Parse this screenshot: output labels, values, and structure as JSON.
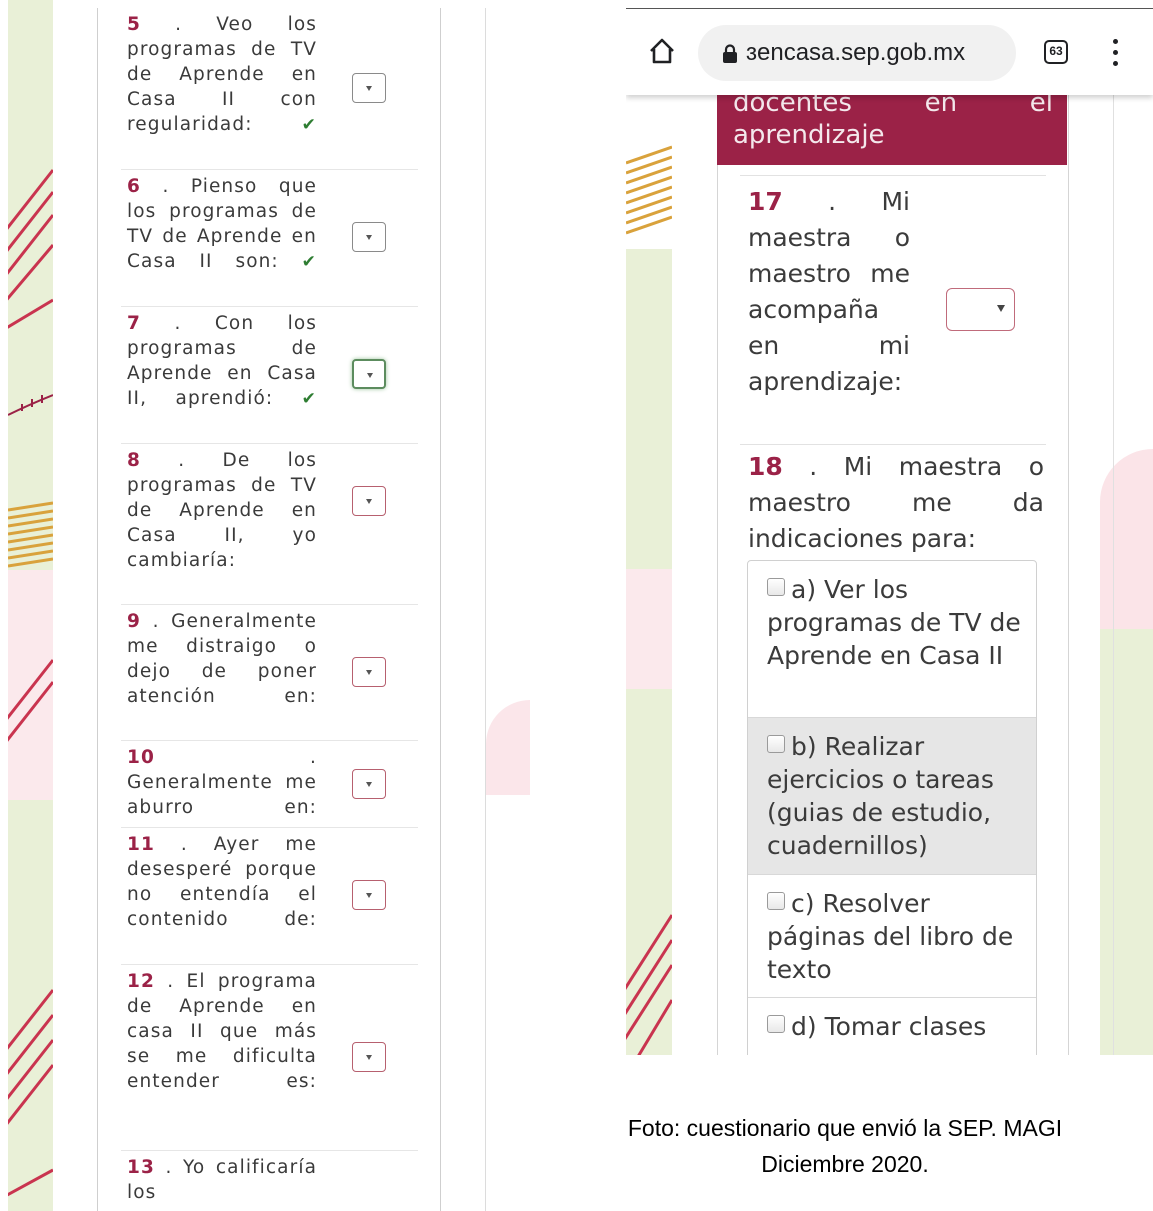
{
  "left_screen": {
    "questions": [
      {
        "number": "5",
        "text": ". Veo los programas de TV de Aprende en Casa II con regularidad:",
        "answered": true
      },
      {
        "number": "6",
        "text": ". Pienso que los programas de TV de Aprende en Casa II son:",
        "answered": true
      },
      {
        "number": "7",
        "text": ". Con los programas de Aprende en Casa II, aprendió:",
        "answered": true
      },
      {
        "number": "8",
        "text": ". De los programas de TV de Aprende en Casa II, yo cambiaría:",
        "answered": false
      },
      {
        "number": "9",
        "text": ". Generalmente me distraigo o dejo de poner atención en:",
        "answered": false
      },
      {
        "number": "10",
        "text": ". Generalmente me aburro en:",
        "answered": false
      },
      {
        "number": "11",
        "text": ". Ayer me desesperé porque no entendía el contenido de:",
        "answered": false
      },
      {
        "number": "12",
        "text": ". El programa de Aprende en casa II que más se me dificulta entender es:",
        "answered": false
      },
      {
        "number": "13",
        "text": ". Yo calificaría los",
        "answered": false
      }
    ],
    "check_glyph": "✔"
  },
  "right_screen": {
    "browser": {
      "url": "ɜencasa.sep.gob.mx",
      "tab_count": "63"
    },
    "section_header": {
      "line1_words": [
        "docentes",
        "en",
        "el"
      ],
      "line2": "aprendizaje"
    },
    "q17": {
      "number": "17",
      "text": ". Mi maestra o maestro me acompaña en mi aprendizaje:"
    },
    "q18": {
      "number": "18",
      "text": ". Mi maestra o maestro me da indicaciones para:",
      "options": [
        {
          "label": "a) Ver los programas de TV de Aprende en Casa II",
          "shaded": false
        },
        {
          "label": "b) Realizar ejercicios o tareas (guias de estudio, cuadernillos)",
          "shaded": true
        },
        {
          "label": "c) Resolver páginas del libro de texto",
          "shaded": false
        },
        {
          "label": "d) Tomar clases",
          "shaded": false
        }
      ]
    }
  },
  "caption": {
    "line1": "Foto: cuestionario que envió la SEP. MAGI",
    "line2": "Diciembre 2020."
  }
}
